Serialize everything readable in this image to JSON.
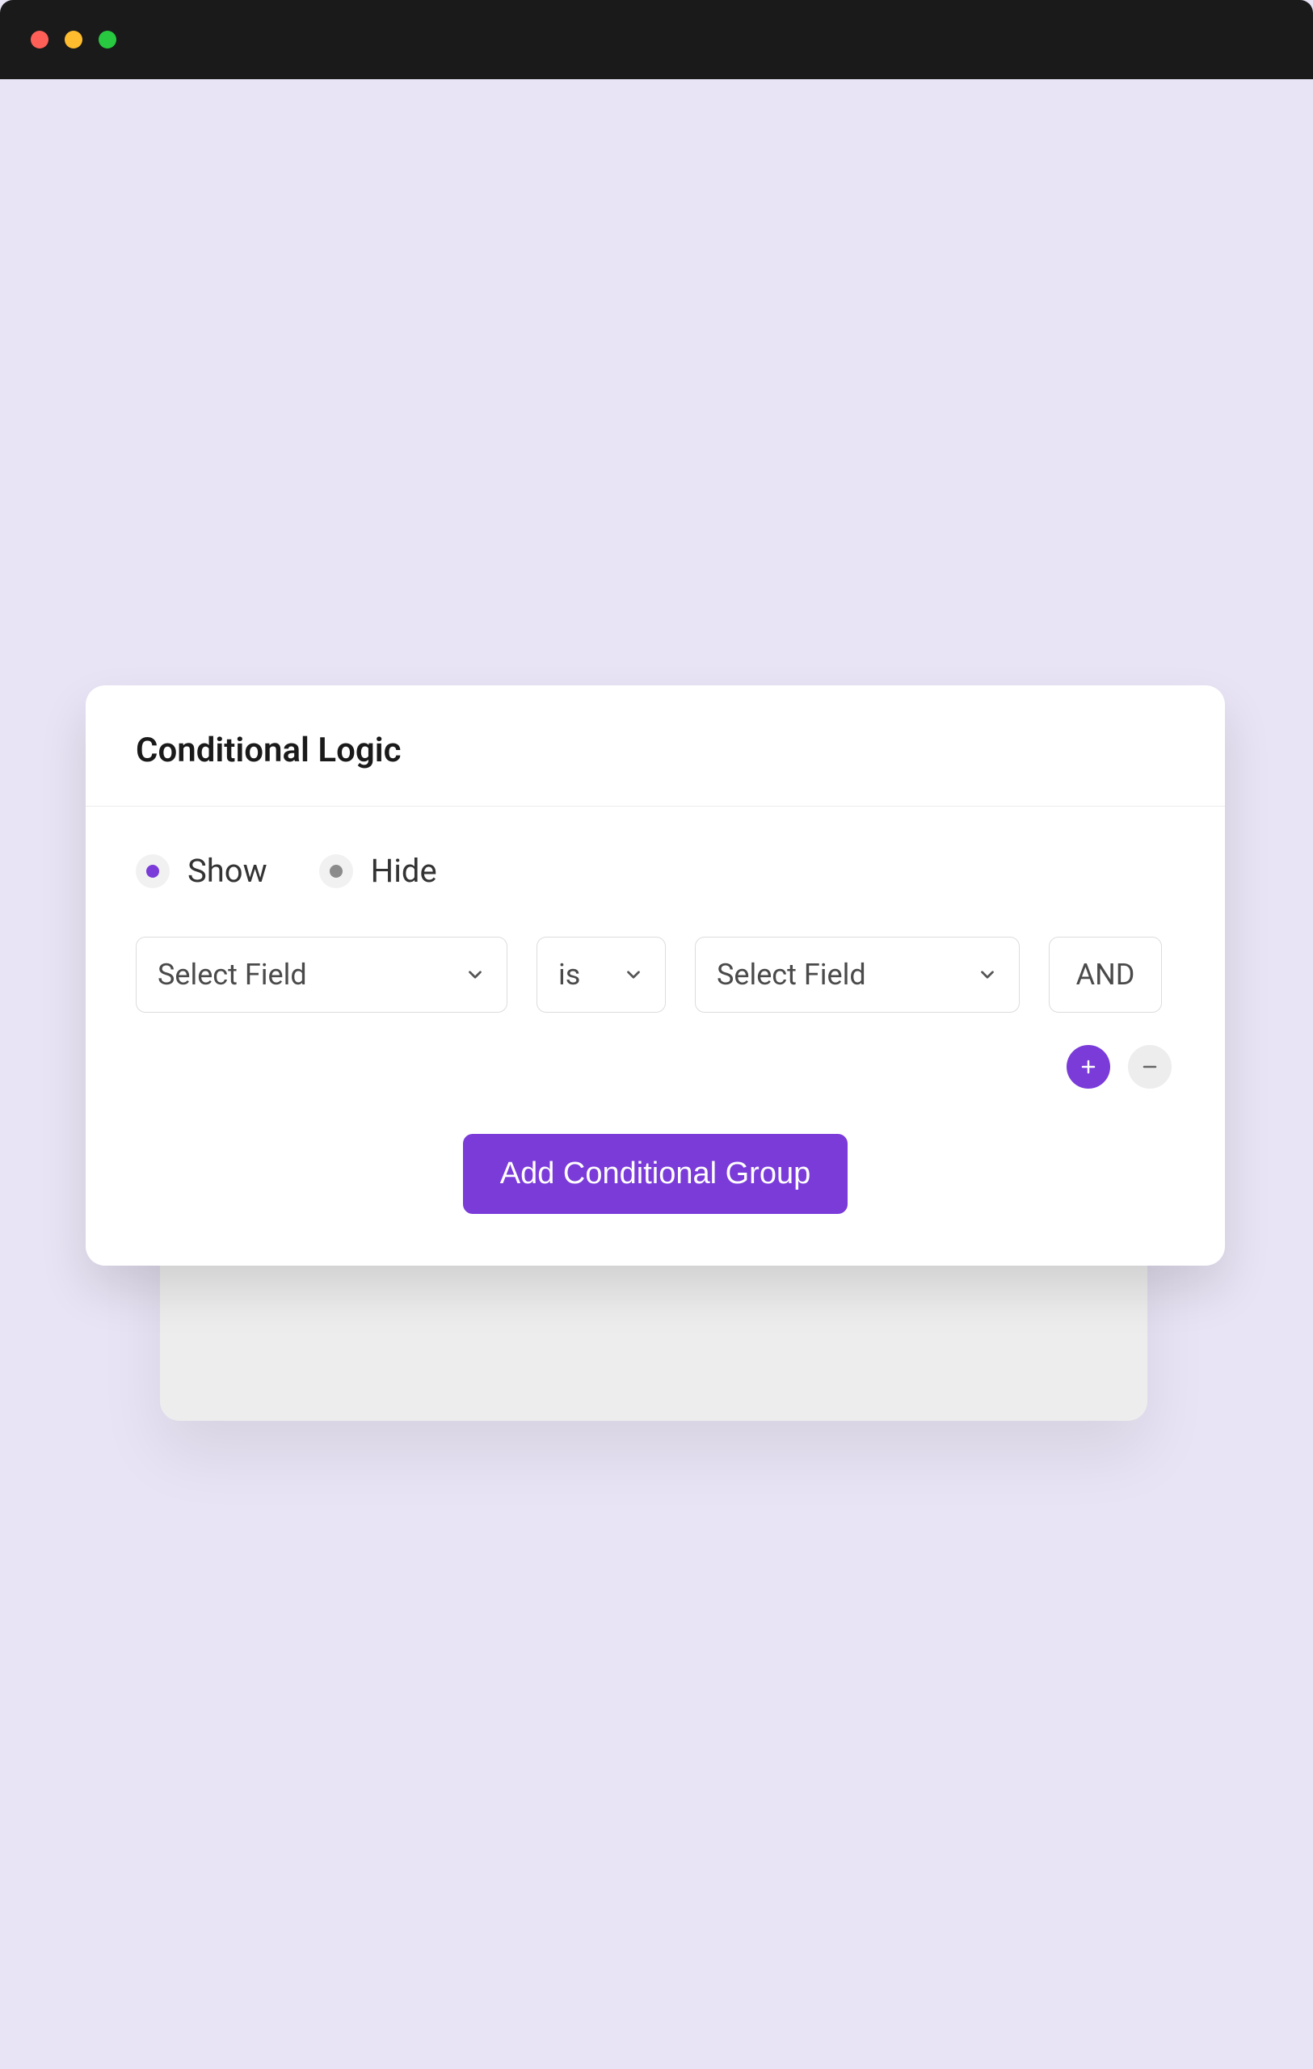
{
  "card": {
    "title": "Conditional Logic",
    "radios": {
      "show": "Show",
      "hide": "Hide"
    },
    "rule": {
      "field1": "Select Field",
      "operator": "is",
      "field2": "Select Field",
      "and": "AND"
    },
    "add_group_label": "Add Conditional Group"
  }
}
